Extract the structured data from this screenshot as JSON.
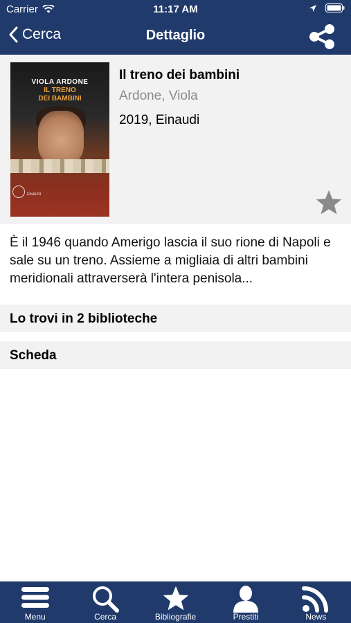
{
  "status_bar": {
    "carrier": "Carrier",
    "time": "11:17 AM"
  },
  "nav": {
    "back_label": "Cerca",
    "title": "Dettaglio"
  },
  "book": {
    "cover": {
      "author": "VIOLA ARDONE",
      "title_line1": "IL TRENO",
      "title_line2": "DEI BAMBINI",
      "publisher_mark": "EINAUDI"
    },
    "title": "Il treno dei bambini",
    "author": "Ardone, Viola",
    "publication": "2019, Einaudi",
    "description": "È il 1946 quando Amerigo lascia il suo rione di Napoli e sale su un treno. Assieme a migliaia di altri bambini meridionali attraverserà l'intera penisola..."
  },
  "sections": {
    "libraries": "Lo trovi in 2 biblioteche",
    "scheda": "Scheda"
  },
  "tabs": [
    {
      "label": "Menu",
      "icon": "menu-icon"
    },
    {
      "label": "Cerca",
      "icon": "search-icon"
    },
    {
      "label": "Bibliografie",
      "icon": "star-icon"
    },
    {
      "label": "Prestiti",
      "icon": "user-icon"
    },
    {
      "label": "News",
      "icon": "rss-icon"
    }
  ],
  "colors": {
    "primary": "#1f3a6b",
    "panel": "#f2f2f2",
    "star": "#8a8a8a"
  }
}
